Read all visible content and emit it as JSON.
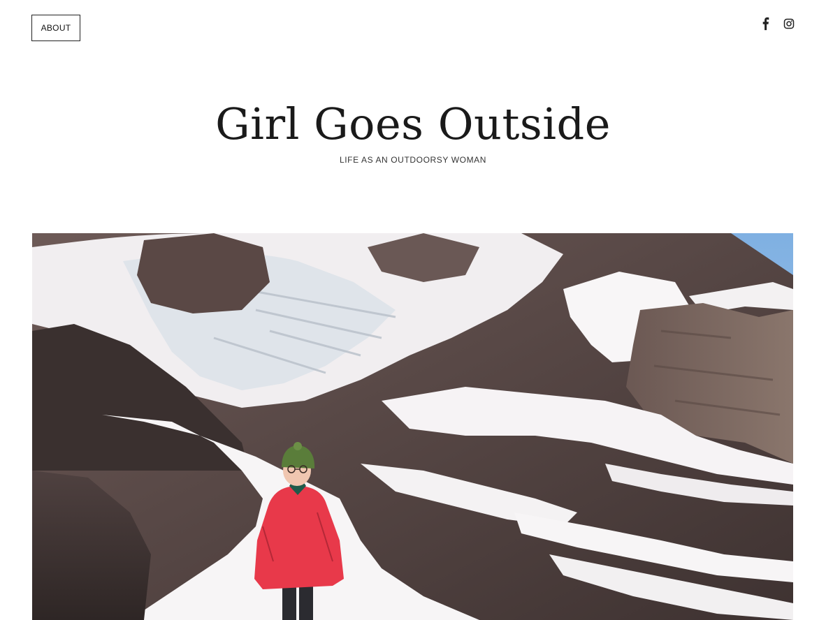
{
  "nav": {
    "about_label": "ABOUT"
  },
  "social": {
    "icons": [
      "facebook-icon",
      "instagram-icon"
    ]
  },
  "header": {
    "title": "Girl Goes Outside",
    "tagline": "LIFE AS AN OUTDOORSY WOMAN"
  },
  "hero": {
    "subject": "hiker-in-red-jacket-mountain-glacier"
  },
  "colors": {
    "text": "#111111",
    "jacket": "#e8394a",
    "rock": "#5b4a48",
    "snow": "#f6f3f4",
    "sky": "#8fb8e0"
  }
}
